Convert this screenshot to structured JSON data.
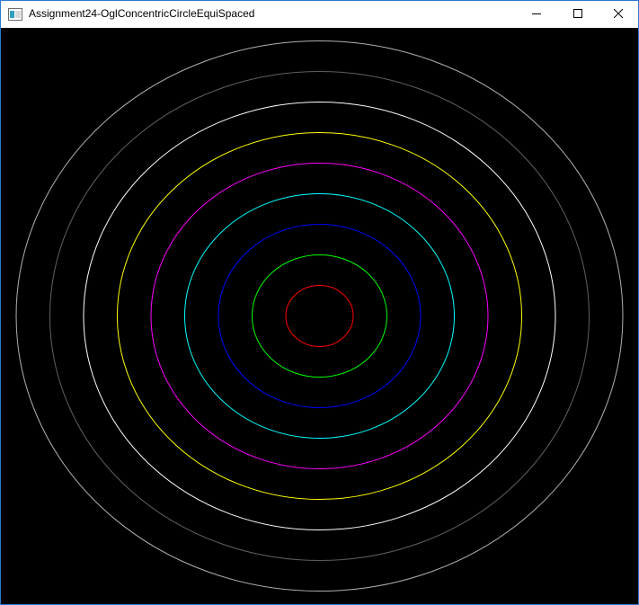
{
  "window": {
    "title": "Assignment24-OglConcentricCircleEquiSpaced",
    "icons": {
      "app": "app-window-icon",
      "minimize": "minimize-icon",
      "maximize": "maximize-icon",
      "close": "close-icon"
    },
    "colors": {
      "titlebar": "#ffffff",
      "border": "#2b79d0",
      "canvas_background": "#000000"
    }
  },
  "scene": {
    "shape": "concentric-circles",
    "circles": [
      {
        "name": "circle-red",
        "color": "#ff0000",
        "ring": 1
      },
      {
        "name": "circle-green",
        "color": "#00ff00",
        "ring": 2
      },
      {
        "name": "circle-blue",
        "color": "#0000ff",
        "ring": 3
      },
      {
        "name": "circle-cyan",
        "color": "#00ffff",
        "ring": 4
      },
      {
        "name": "circle-magenta",
        "color": "#ff00ff",
        "ring": 5
      },
      {
        "name": "circle-yellow",
        "color": "#ffff00",
        "ring": 6
      },
      {
        "name": "circle-white",
        "color": "#ffffff",
        "ring": 7
      },
      {
        "name": "circle-dark-gray",
        "color": "#606060",
        "ring": 8
      },
      {
        "name": "circle-light-gray",
        "color": "#b0b0b0",
        "ring": 9
      }
    ]
  }
}
